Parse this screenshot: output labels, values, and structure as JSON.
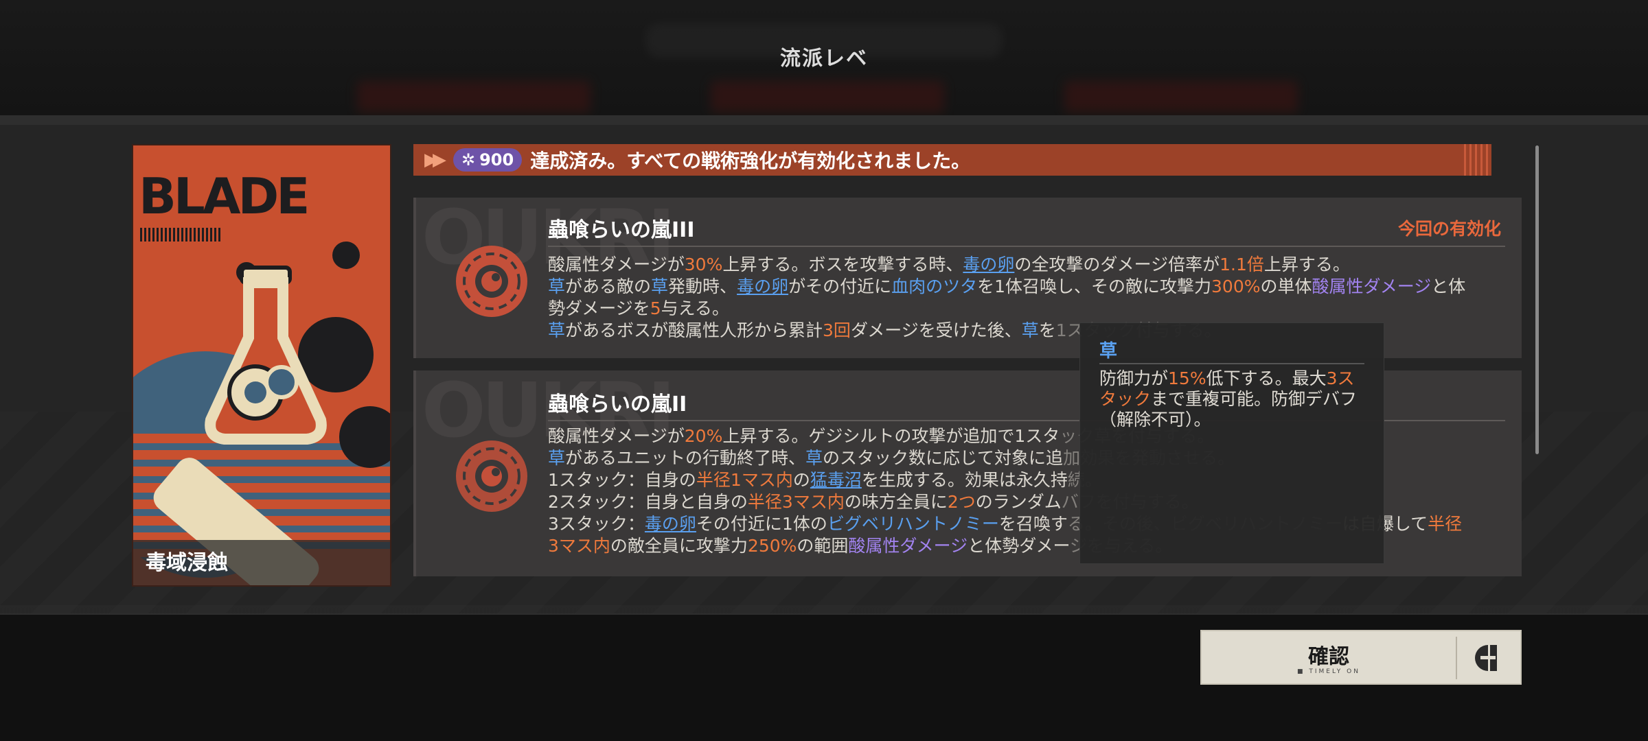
{
  "page": {
    "title": "流派レベ"
  },
  "card": {
    "name": "毒域浸蝕",
    "header_text": "BLADE"
  },
  "banner": {
    "pill_value": "900",
    "message": "達成済み。すべての戦術強化が有効化されました。"
  },
  "skills": [
    {
      "title": "蟲喰らいの嵐III",
      "status": "今回の有効化",
      "lines": [
        [
          [
            "t",
            "酸属性ダメージが"
          ],
          [
            "o",
            "30%"
          ],
          [
            "t",
            "上昇する。ボスを攻撃する時、"
          ],
          [
            "bu",
            "毒の卵"
          ],
          [
            "t",
            "の全攻撃のダメージ倍率が"
          ],
          [
            "o",
            "1.1倍"
          ],
          [
            "t",
            "上昇する。"
          ]
        ],
        [
          [
            "b",
            "草"
          ],
          [
            "t",
            "がある敵の"
          ],
          [
            "b",
            "草"
          ],
          [
            "t",
            "発動時、"
          ],
          [
            "bu",
            "毒の卵"
          ],
          [
            "t",
            "がその付近に"
          ],
          [
            "b",
            "血肉のツタ"
          ],
          [
            "t",
            "を1体召喚し、その敵に攻撃力"
          ],
          [
            "o",
            "300%"
          ],
          [
            "t",
            "の単体"
          ],
          [
            "p",
            "酸属性ダメージ"
          ],
          [
            "t",
            "と体"
          ]
        ],
        [
          [
            "t",
            "勢ダメージを"
          ],
          [
            "o",
            "5"
          ],
          [
            "t",
            "与える。"
          ]
        ],
        [
          [
            "b",
            "草"
          ],
          [
            "t",
            "があるボスが酸属性人形から累計"
          ],
          [
            "o",
            "3回"
          ],
          [
            "t",
            "ダメージを受けた後、"
          ],
          [
            "b",
            "草"
          ],
          [
            "t",
            "を"
          ],
          [
            "d",
            "1スタック付与する。"
          ]
        ]
      ]
    },
    {
      "title": "蟲喰らいの嵐II",
      "status": "",
      "lines": [
        [
          [
            "t",
            "酸属性ダメージが"
          ],
          [
            "o",
            "20%"
          ],
          [
            "t",
            "上昇する。ゲジシルトの攻撃が追加で1スタ"
          ],
          [
            "d",
            "ック草を付与する。"
          ]
        ],
        [
          [
            "b",
            "草"
          ],
          [
            "t",
            "があるユニットの行動終了時、"
          ],
          [
            "b",
            "草"
          ],
          [
            "t",
            "のスタック数に応じて対象に追"
          ],
          [
            "d",
            "加効果を発動させる。"
          ]
        ],
        [
          [
            "t",
            "1スタック：自身の"
          ],
          [
            "o",
            "半径1マス内"
          ],
          [
            "t",
            "の"
          ],
          [
            "bu",
            "猛毒沼"
          ],
          [
            "t",
            "を生成する。効果は永久持"
          ],
          [
            "d",
            "続。"
          ]
        ],
        [
          [
            "t",
            "2スタック：自身と自身の"
          ],
          [
            "o",
            "半径3マス内"
          ],
          [
            "t",
            "の味方全員に"
          ],
          [
            "o",
            "2つ"
          ],
          [
            "t",
            "のランダム"
          ],
          [
            "d",
            "バフを付与する。"
          ]
        ],
        [
          [
            "t",
            "3スタック："
          ],
          [
            "bu",
            "毒の卵"
          ],
          [
            "t",
            "その付近に1体の"
          ],
          [
            "b",
            "ビグベリハントノミー"
          ],
          [
            "t",
            "を召喚す"
          ],
          [
            "d",
            "る。その後、ビグベリハントノミー"
          ],
          [
            "t",
            "は自爆して"
          ],
          [
            "o",
            "半径"
          ]
        ],
        [
          [
            "o",
            "3マス内"
          ],
          [
            "t",
            "の敵全員に攻撃力"
          ],
          [
            "o",
            "250%"
          ],
          [
            "t",
            "の範囲"
          ],
          [
            "p",
            "酸属性ダメージ"
          ],
          [
            "t",
            "と体勢ダメー"
          ],
          [
            "d",
            "ジを与える。"
          ]
        ]
      ]
    }
  ],
  "tooltip": {
    "title": "草",
    "segments": [
      [
        "t",
        "防御力が"
      ],
      [
        "o",
        "15%"
      ],
      [
        "t",
        "低下する。最大"
      ],
      [
        "o",
        "3スタック"
      ],
      [
        "t",
        "まで重複可能。防御デバフ（解除不可）。"
      ]
    ]
  },
  "confirm": {
    "label": "確認",
    "sub": "■ TIMELY ON"
  },
  "colors": {
    "accent_orange": "#f07a3c",
    "keyword_blue": "#5aa0f0",
    "keyword_purple": "#a283f0",
    "banner": "#9c4228",
    "card": "#c8502f"
  }
}
